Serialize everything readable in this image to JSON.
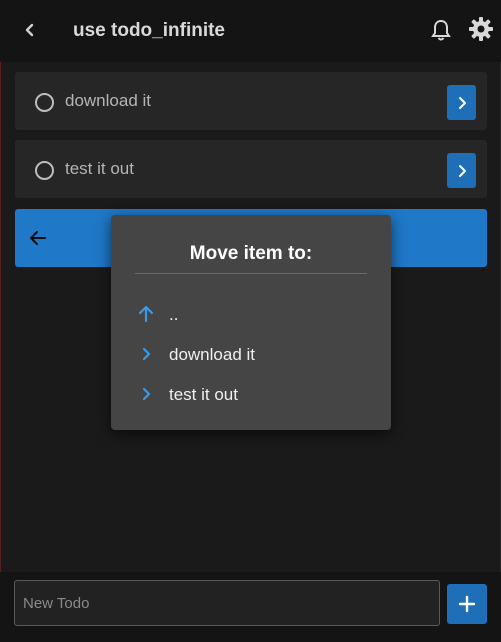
{
  "header": {
    "title": "use todo_infinite",
    "back_icon": "chevron-left-icon",
    "notification_icon": "bell-icon",
    "settings_icon": "gear-icon"
  },
  "todos": [
    {
      "label": "download it",
      "status_icon": "circle-outline-icon",
      "action_icon": "chevron-right-icon"
    },
    {
      "label": "test it out",
      "status_icon": "circle-outline-icon",
      "action_icon": "chevron-right-icon"
    }
  ],
  "selected_row": {
    "icon": "arrow-left-icon"
  },
  "move_dialog": {
    "title": "Move item to:",
    "options": [
      {
        "label": "..",
        "icon": "arrow-up-icon"
      },
      {
        "label": "download it",
        "icon": "chevron-right-icon"
      },
      {
        "label": "test it out",
        "icon": "chevron-right-icon"
      }
    ]
  },
  "footer": {
    "input_placeholder": "New Todo",
    "input_value": "",
    "add_icon": "plus-icon"
  },
  "colors": {
    "accent": "#1f78c8",
    "background": "#1a1a1a",
    "dialog": "#454545"
  }
}
